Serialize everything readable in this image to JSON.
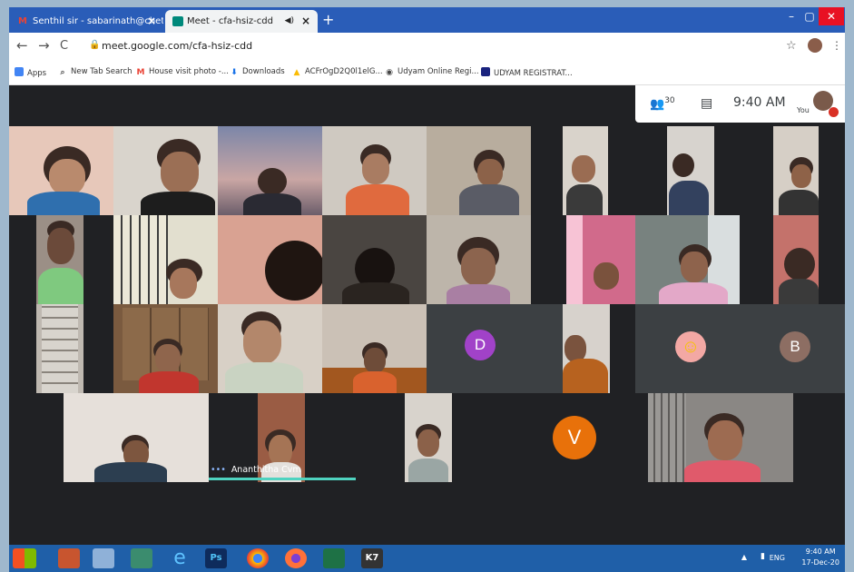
{
  "browser": {
    "tabs": [
      {
        "label": "Senthil sir - sabarinath@chettina",
        "icon": "gmail-icon",
        "active": false
      },
      {
        "label": "Meet - cfa-hsiz-cdd",
        "icon": "meet-icon",
        "active": true
      }
    ],
    "new_tab": "+",
    "window_buttons": {
      "minimize": "–",
      "maximize": "▢",
      "close": "✕"
    },
    "nav": {
      "back": "←",
      "forward": "→",
      "reload": "C"
    },
    "url": "meet.google.com/cfa-hsiz-cdd",
    "bookmarks": [
      {
        "label": "Apps",
        "icon": "apps-grid-icon"
      },
      {
        "label": "New Tab Search",
        "icon": "search-icon"
      },
      {
        "label": "House visit photo -...",
        "icon": "gmail-icon"
      },
      {
        "label": "Downloads",
        "icon": "download-icon"
      },
      {
        "label": "ACFrOgD2Q0l1elG...",
        "icon": "drive-icon"
      },
      {
        "label": "Udyam Online Regi...",
        "icon": "globe-icon"
      },
      {
        "label": "UDYAM REGISTRAT...",
        "icon": "udyam-icon"
      }
    ]
  },
  "meet": {
    "participant_count": "30",
    "time": "9:40 AM",
    "self_label": "You",
    "initials": [
      {
        "letter": "D",
        "color": "#a142c8"
      },
      {
        "letter": "V",
        "color": "#e8710a"
      },
      {
        "letter": "B",
        "color": "#8d6e63"
      }
    ],
    "active_speaker_name": "Ananthitha Cvm",
    "more_options": "•••"
  },
  "taskbar": {
    "lang": "ENG",
    "time": "9:40 AM",
    "date": "17-Dec-20"
  }
}
